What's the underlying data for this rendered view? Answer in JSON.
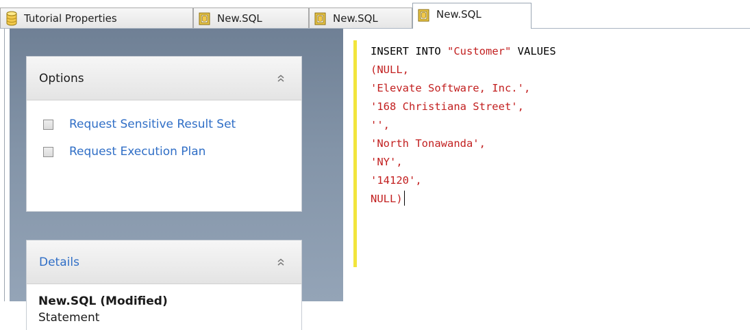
{
  "tabs": [
    {
      "label": "Tutorial Properties",
      "icon": "database-cylinder-icon",
      "active": false
    },
    {
      "label": "New.SQL",
      "icon": "sql-file-icon",
      "active": false
    },
    {
      "label": "New.SQL",
      "icon": "sql-file-icon",
      "active": false
    },
    {
      "label": "New.SQL",
      "icon": "sql-file-icon",
      "active": true
    }
  ],
  "options": {
    "title": "Options",
    "items": [
      {
        "label": "Request Sensitive Result Set",
        "checked": false
      },
      {
        "label": "Request Execution Plan",
        "checked": false
      }
    ]
  },
  "details": {
    "title": "Details",
    "name": "New.SQL (Modified)",
    "type": "Statement"
  },
  "editor": {
    "lines": [
      {
        "keyword": "INSERT INTO",
        "ident": "\"Customer\"",
        "tail": " VALUES"
      },
      {
        "text": "(NULL,"
      },
      {
        "text": "'Elevate Software, Inc.',"
      },
      {
        "text": "'168 Christiana Street',"
      },
      {
        "text": "'',"
      },
      {
        "text": "'North Tonawanda',"
      },
      {
        "text": "'NY',"
      },
      {
        "text": "'14120',"
      },
      {
        "text": "NULL)"
      }
    ]
  },
  "colors": {
    "string": "#c21f1f",
    "keyword": "#000000",
    "link": "#2f6ec6",
    "change_bar": "#f2e53c",
    "panel_background": "#7f90a5"
  }
}
